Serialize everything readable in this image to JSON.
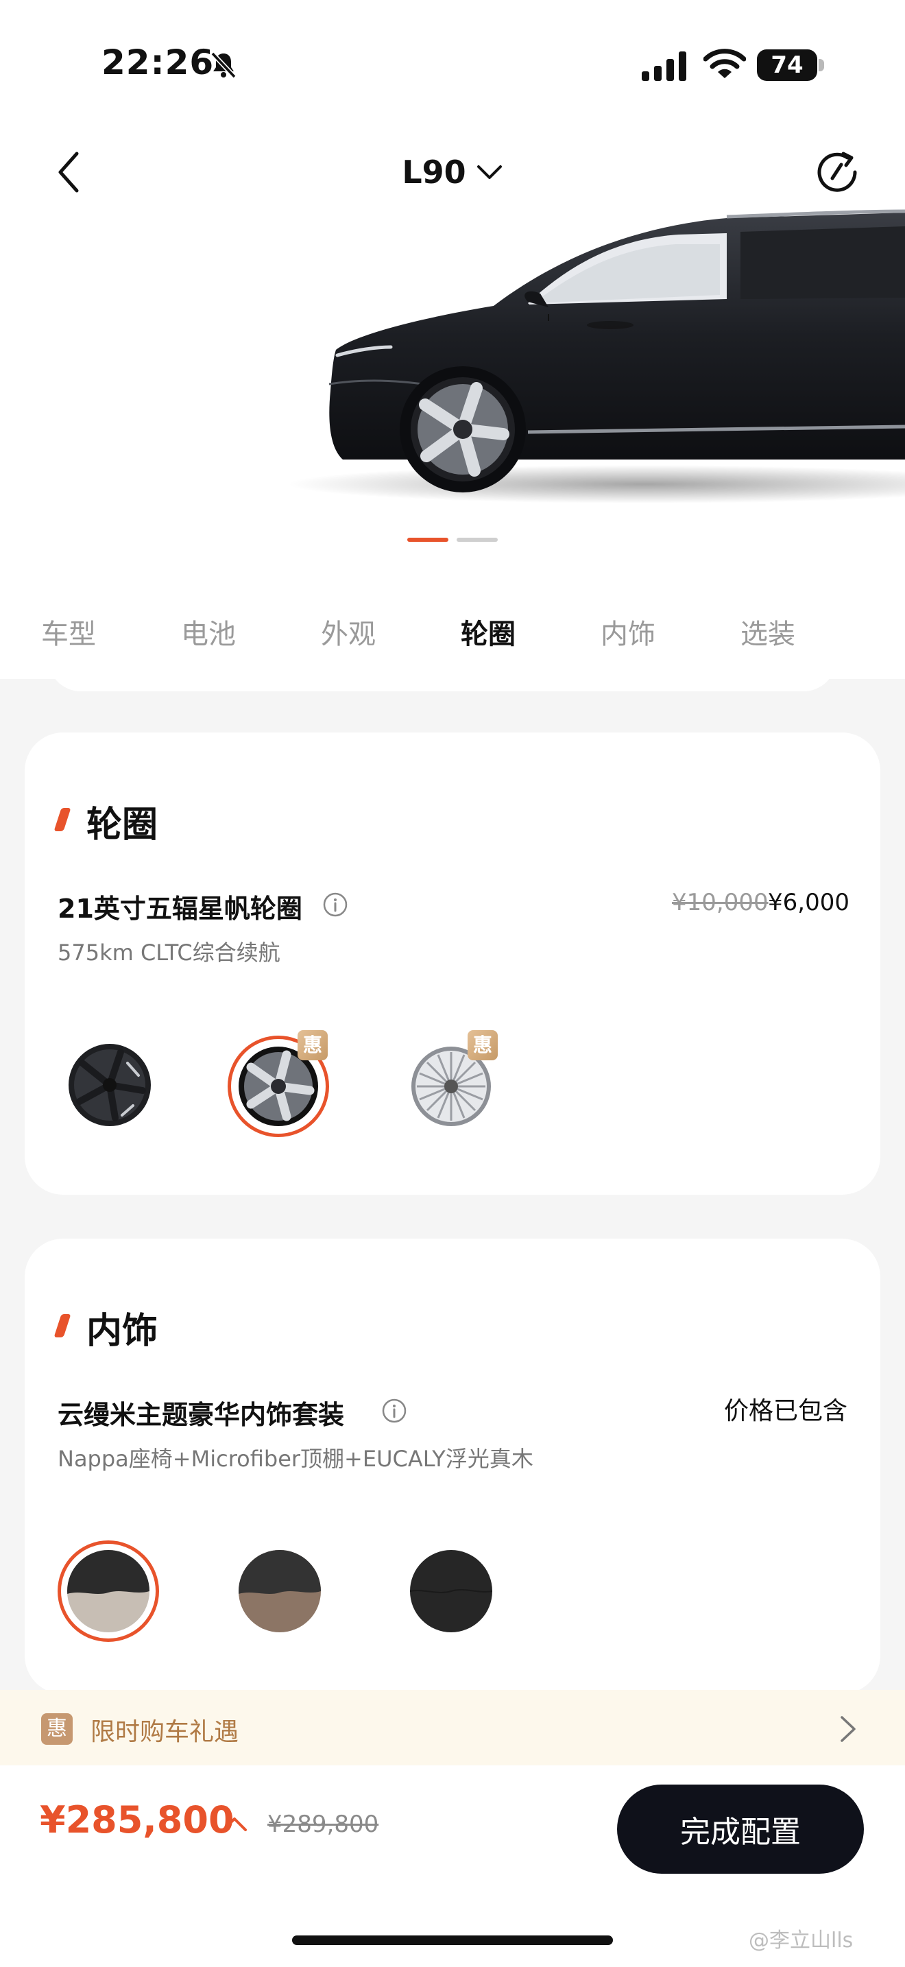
{
  "status_bar": {
    "time": "22:26",
    "battery": "74",
    "icons": [
      "bell-slash-icon",
      "cellular-signal-icon",
      "wifi-icon",
      "battery-icon"
    ]
  },
  "header": {
    "model": "L90",
    "icons": [
      "back-chevron-icon",
      "chevron-down-icon",
      "reset-icon"
    ]
  },
  "carousel": {
    "slide_count": 2,
    "active_slide": 1
  },
  "tabs": [
    {
      "label": "车型",
      "active": false
    },
    {
      "label": "电池",
      "active": false
    },
    {
      "label": "外观",
      "active": false
    },
    {
      "label": "轮圈",
      "active": true
    },
    {
      "label": "内饰",
      "active": false
    },
    {
      "label": "选装",
      "active": false
    }
  ],
  "wheel_section": {
    "title": "轮圈",
    "option_name": "21英寸五辐星帆轮圈",
    "description": "575km CLTC综合续航",
    "price_old": "¥10,000",
    "price_new": "¥6,000",
    "badge": "惠",
    "options": [
      {
        "name": "black-aero-wheel",
        "selected": false,
        "badge": false
      },
      {
        "name": "five-spoke-starsail-wheel",
        "selected": true,
        "badge": true
      },
      {
        "name": "multi-spoke-silver-wheel",
        "selected": false,
        "badge": true
      }
    ]
  },
  "interior_section": {
    "title": "内饰",
    "option_name": "云缦米主题豪华内饰套装",
    "description": "Nappa座椅+Microfiber顶棚+EUCALY浮光真木",
    "price_note": "价格已包含",
    "options": [
      {
        "name": "cloud-cream-interior",
        "selected": true,
        "top_color": "#2b2b2b",
        "bottom_color": "#c7beb4"
      },
      {
        "name": "brown-interior",
        "selected": false,
        "top_color": "#333333",
        "bottom_color": "#8c7565"
      },
      {
        "name": "black-interior",
        "selected": false,
        "top_color": "#262626",
        "bottom_color": "#262626"
      }
    ]
  },
  "promo": {
    "badge": "惠",
    "label": "限时购车礼遇"
  },
  "bottom_bar": {
    "price_current": "¥285,800",
    "price_original": "¥289,800",
    "button_label": "完成配置",
    "watermark": "@李立山lls"
  },
  "colors": {
    "accent": "#e8532b",
    "button": "#0f111a",
    "promo_bg": "#fdf8ec",
    "promo_text": "#b07a45"
  }
}
